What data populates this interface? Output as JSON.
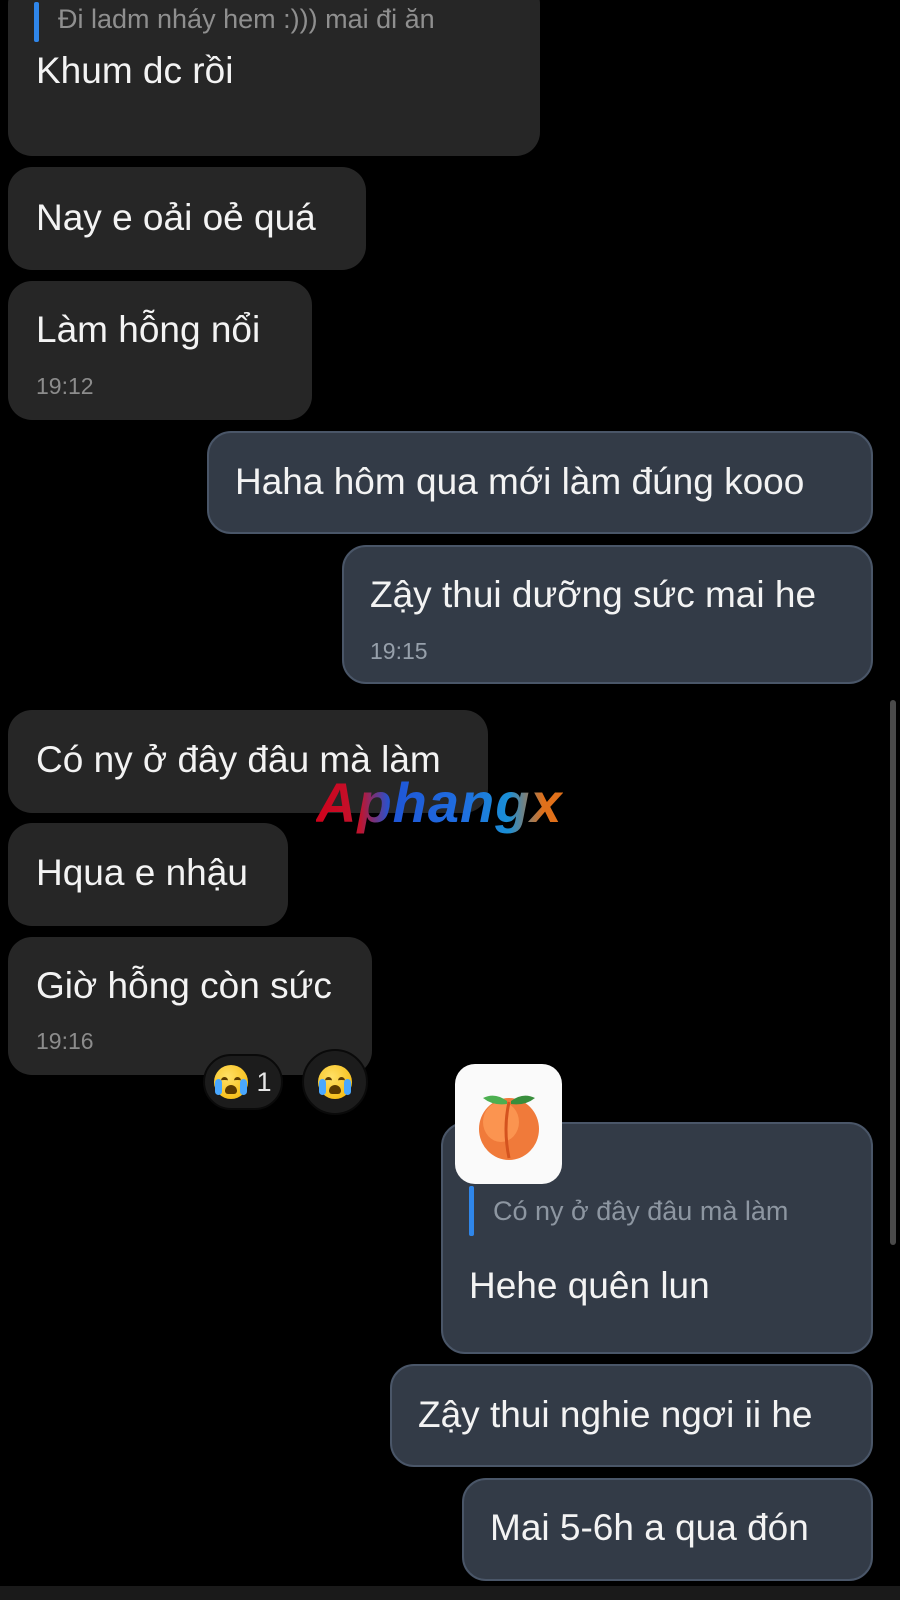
{
  "conversation": {
    "messages": [
      {
        "id": "m1",
        "side": "in",
        "quote": "Đi ladm nháy hem :))) mai đi ăn",
        "text": "Khum dc rồi"
      },
      {
        "id": "m2",
        "side": "in",
        "text": "Nay e oải oẻ quá"
      },
      {
        "id": "m3",
        "side": "in",
        "text": "Làm hỗng nổi",
        "time": "19:12"
      },
      {
        "id": "m4",
        "side": "out",
        "text": "Haha hôm qua mới làm đúng kooo"
      },
      {
        "id": "m5",
        "side": "out",
        "text": "Zậy thui dưỡng sức mai he",
        "time": "19:15"
      },
      {
        "id": "m6",
        "side": "in",
        "text": "Có ny ở đây đâu mà làm"
      },
      {
        "id": "m7",
        "side": "in",
        "text": "Hqua e nhậu"
      },
      {
        "id": "m8",
        "side": "in",
        "text": "Giờ hỗng còn sức",
        "time": "19:16"
      },
      {
        "id": "m9",
        "side": "out",
        "quote": "Có ny ở đây đâu mà làm",
        "text": "Hehe quên lun",
        "sticker": "peach-emoji"
      },
      {
        "id": "m10",
        "side": "out",
        "text": "Zậy thui nghie ngơi ii he"
      },
      {
        "id": "m11",
        "side": "out",
        "text": "Mai 5-6h a qua đón"
      }
    ],
    "reactions": {
      "emoji": "crying-face-icon",
      "count": "1"
    }
  },
  "watermark": "Aphangx",
  "colors": {
    "background": "#000000",
    "incoming_bubble": "#262626",
    "outgoing_bubble": "#333b47",
    "quote_bar": "#2f86ea",
    "timestamp": "#8c8c8c"
  }
}
